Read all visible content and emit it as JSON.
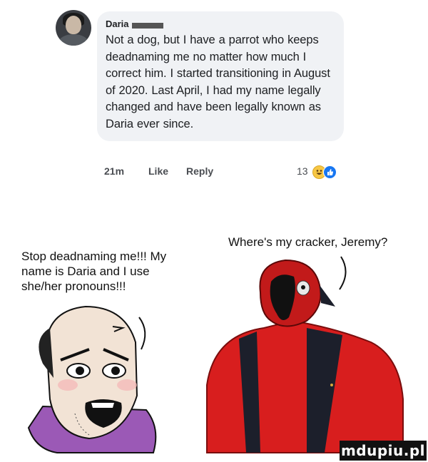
{
  "comment": {
    "author": "Daria",
    "text": "Not a dog, but I have a parrot who keeps deadnaming me no matter how much I correct him. I started transitioning in August of 2020. Last April, I had my name legally changed and have been legally known as Daria ever since.",
    "time": "21m",
    "like_label": "Like",
    "reply_label": "Reply",
    "reaction_count": "13",
    "reactions": [
      "haha-icon",
      "like-icon"
    ]
  },
  "meme": {
    "left_caption": "Stop deadnaming me!!! My name is Daria and I use she/her pronouns!!!",
    "right_caption": "Where's my cracker, Jeremy?"
  },
  "colors": {
    "bubble": "#f0f2f5",
    "like_blue": "#1877f2",
    "parrot_red": "#d81e1e"
  },
  "watermark": "mdupiu.pl"
}
